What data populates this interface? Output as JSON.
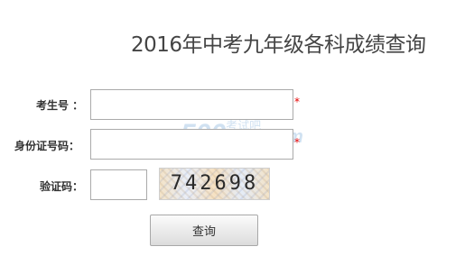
{
  "page": {
    "title": "2016年中考九年级各科成绩查询"
  },
  "form": {
    "exam_number": {
      "label": "考生号 ：",
      "value": "",
      "required_mark": "*"
    },
    "id_number": {
      "label": "身份证号码：",
      "value": "",
      "required_mark": "*"
    },
    "captcha": {
      "label": "验证码：",
      "value": "",
      "image_text": "742698"
    },
    "submit_label": "查询"
  },
  "watermark": {
    "logo_text": "500",
    "site_text": "考试吧",
    "domain": ".com"
  }
}
